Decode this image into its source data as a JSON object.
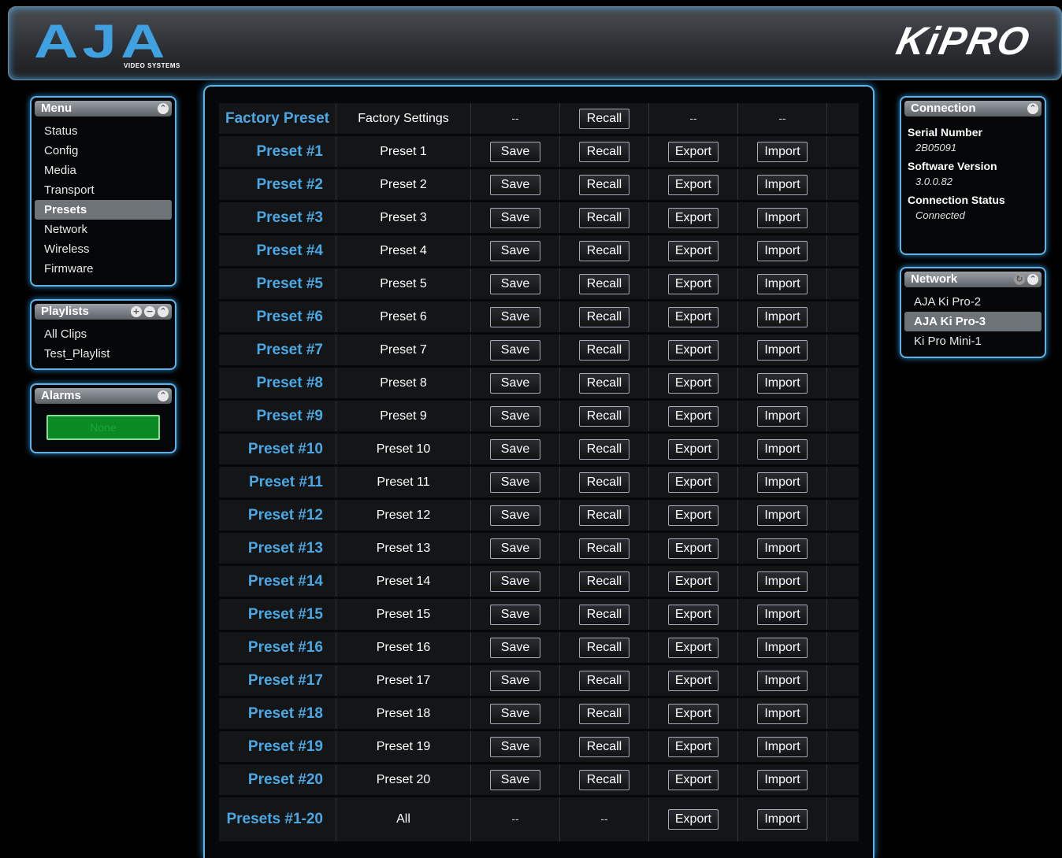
{
  "header": {
    "logo_big": "AJA",
    "logo_small": "VIDEO SYSTEMS",
    "product_logo": "KiPRO"
  },
  "menu_panel": {
    "title": "Menu",
    "items": [
      "Status",
      "Config",
      "Media",
      "Transport",
      "Presets",
      "Network",
      "Wireless",
      "Firmware"
    ],
    "selected": "Presets"
  },
  "playlists_panel": {
    "title": "Playlists",
    "items": [
      "All Clips",
      "Test_Playlist"
    ]
  },
  "alarms_panel": {
    "title": "Alarms",
    "status": "None",
    "status_color": "#0b8a23"
  },
  "connection_panel": {
    "title": "Connection",
    "serial_label": "Serial Number",
    "serial_value": "2B05091",
    "software_label": "Software Version",
    "software_value": "3.0.0.82",
    "status_label": "Connection Status",
    "status_value": "Connected"
  },
  "network_panel": {
    "title": "Network",
    "items": [
      "AJA Ki Pro-2",
      "AJA Ki Pro-3",
      "Ki Pro Mini-1"
    ],
    "selected": "AJA Ki Pro-3"
  },
  "presets": {
    "factory": {
      "name": "Factory Preset",
      "desc": "Factory Settings",
      "save": "--",
      "recall": "Recall",
      "export": "--",
      "import": "--"
    },
    "rows": [
      {
        "name": "Preset #1",
        "desc": "Preset 1",
        "save": "Save",
        "recall": "Recall",
        "export": "Export",
        "import": "Import"
      },
      {
        "name": "Preset #2",
        "desc": "Preset 2",
        "save": "Save",
        "recall": "Recall",
        "export": "Export",
        "import": "Import"
      },
      {
        "name": "Preset #3",
        "desc": "Preset 3",
        "save": "Save",
        "recall": "Recall",
        "export": "Export",
        "import": "Import"
      },
      {
        "name": "Preset #4",
        "desc": "Preset 4",
        "save": "Save",
        "recall": "Recall",
        "export": "Export",
        "import": "Import"
      },
      {
        "name": "Preset #5",
        "desc": "Preset 5",
        "save": "Save",
        "recall": "Recall",
        "export": "Export",
        "import": "Import"
      },
      {
        "name": "Preset #6",
        "desc": "Preset 6",
        "save": "Save",
        "recall": "Recall",
        "export": "Export",
        "import": "Import"
      },
      {
        "name": "Preset #7",
        "desc": "Preset 7",
        "save": "Save",
        "recall": "Recall",
        "export": "Export",
        "import": "Import"
      },
      {
        "name": "Preset #8",
        "desc": "Preset 8",
        "save": "Save",
        "recall": "Recall",
        "export": "Export",
        "import": "Import"
      },
      {
        "name": "Preset #9",
        "desc": "Preset 9",
        "save": "Save",
        "recall": "Recall",
        "export": "Export",
        "import": "Import"
      },
      {
        "name": "Preset #10",
        "desc": "Preset 10",
        "save": "Save",
        "recall": "Recall",
        "export": "Export",
        "import": "Import"
      },
      {
        "name": "Preset #11",
        "desc": "Preset 11",
        "save": "Save",
        "recall": "Recall",
        "export": "Export",
        "import": "Import"
      },
      {
        "name": "Preset #12",
        "desc": "Preset 12",
        "save": "Save",
        "recall": "Recall",
        "export": "Export",
        "import": "Import"
      },
      {
        "name": "Preset #13",
        "desc": "Preset 13",
        "save": "Save",
        "recall": "Recall",
        "export": "Export",
        "import": "Import"
      },
      {
        "name": "Preset #14",
        "desc": "Preset 14",
        "save": "Save",
        "recall": "Recall",
        "export": "Export",
        "import": "Import"
      },
      {
        "name": "Preset #15",
        "desc": "Preset 15",
        "save": "Save",
        "recall": "Recall",
        "export": "Export",
        "import": "Import"
      },
      {
        "name": "Preset #16",
        "desc": "Preset 16",
        "save": "Save",
        "recall": "Recall",
        "export": "Export",
        "import": "Import"
      },
      {
        "name": "Preset #17",
        "desc": "Preset 17",
        "save": "Save",
        "recall": "Recall",
        "export": "Export",
        "import": "Import"
      },
      {
        "name": "Preset #18",
        "desc": "Preset 18",
        "save": "Save",
        "recall": "Recall",
        "export": "Export",
        "import": "Import"
      },
      {
        "name": "Preset #19",
        "desc": "Preset 19",
        "save": "Save",
        "recall": "Recall",
        "export": "Export",
        "import": "Import"
      },
      {
        "name": "Preset #20",
        "desc": "Preset 20",
        "save": "Save",
        "recall": "Recall",
        "export": "Export",
        "import": "Import"
      }
    ],
    "all": {
      "name": "Presets #1-20",
      "desc": "All",
      "save": "--",
      "recall": "--",
      "export": "Export",
      "import": "Import"
    }
  }
}
